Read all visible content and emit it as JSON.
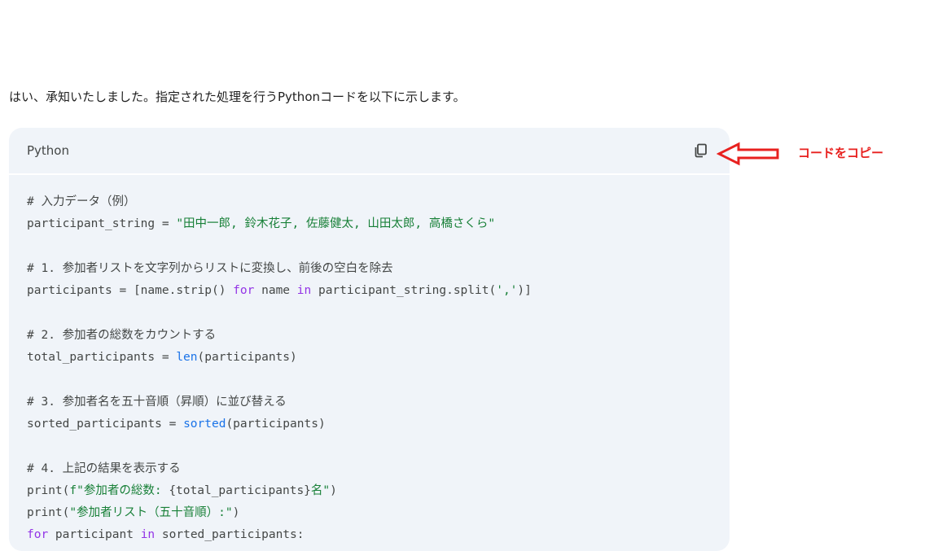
{
  "message": {
    "intro_text": "はい、承知いたしました。指定された処理を行うPythonコードを以下に示します。"
  },
  "code_block": {
    "language": "Python",
    "copy_icon": "copy-icon",
    "lines": [
      [
        {
          "t": "c",
          "v": "# 入力データ（例）"
        }
      ],
      [
        {
          "t": "p",
          "v": "participant_string = "
        },
        {
          "t": "s",
          "v": "\"田中一郎, 鈴木花子, 佐藤健太, 山田太郎, 高橋さくら\""
        }
      ],
      [],
      [
        {
          "t": "c",
          "v": "# 1. 参加者リストを文字列からリストに変換し、前後の空白を除去"
        }
      ],
      [
        {
          "t": "p",
          "v": "participants = [name.strip() "
        },
        {
          "t": "k",
          "v": "for"
        },
        {
          "t": "p",
          "v": " name "
        },
        {
          "t": "k",
          "v": "in"
        },
        {
          "t": "p",
          "v": " participant_string.split("
        },
        {
          "t": "s",
          "v": "','"
        },
        {
          "t": "p",
          "v": ")]"
        }
      ],
      [],
      [
        {
          "t": "c",
          "v": "# 2. 参加者の総数をカウントする"
        }
      ],
      [
        {
          "t": "p",
          "v": "total_participants = "
        },
        {
          "t": "f",
          "v": "len"
        },
        {
          "t": "p",
          "v": "(participants)"
        }
      ],
      [],
      [
        {
          "t": "c",
          "v": "# 3. 参加者名を五十音順（昇順）に並び替える"
        }
      ],
      [
        {
          "t": "p",
          "v": "sorted_participants = "
        },
        {
          "t": "f",
          "v": "sorted"
        },
        {
          "t": "p",
          "v": "(participants)"
        }
      ],
      [],
      [
        {
          "t": "c",
          "v": "# 4. 上記の結果を表示する"
        }
      ],
      [
        {
          "t": "p",
          "v": "print("
        },
        {
          "t": "s",
          "v": "f\"参加者の総数: "
        },
        {
          "t": "p",
          "v": "{total_participants}"
        },
        {
          "t": "s",
          "v": "名\""
        },
        {
          "t": "p",
          "v": ")"
        }
      ],
      [
        {
          "t": "p",
          "v": "print("
        },
        {
          "t": "s",
          "v": "\"参加者リスト（五十音順）:\""
        },
        {
          "t": "p",
          "v": ")"
        }
      ],
      [
        {
          "t": "k",
          "v": "for"
        },
        {
          "t": "p",
          "v": " participant "
        },
        {
          "t": "k",
          "v": "in"
        },
        {
          "t": "p",
          "v": " sorted_participants:"
        }
      ]
    ]
  },
  "annotation": {
    "label": "コードをコピー",
    "color": "#e8211f"
  },
  "colors": {
    "card_bg": "#f0f4f9",
    "string": "#188038",
    "keyword": "#9334e6",
    "builtin": "#1a73e8",
    "plain": "#444746"
  }
}
